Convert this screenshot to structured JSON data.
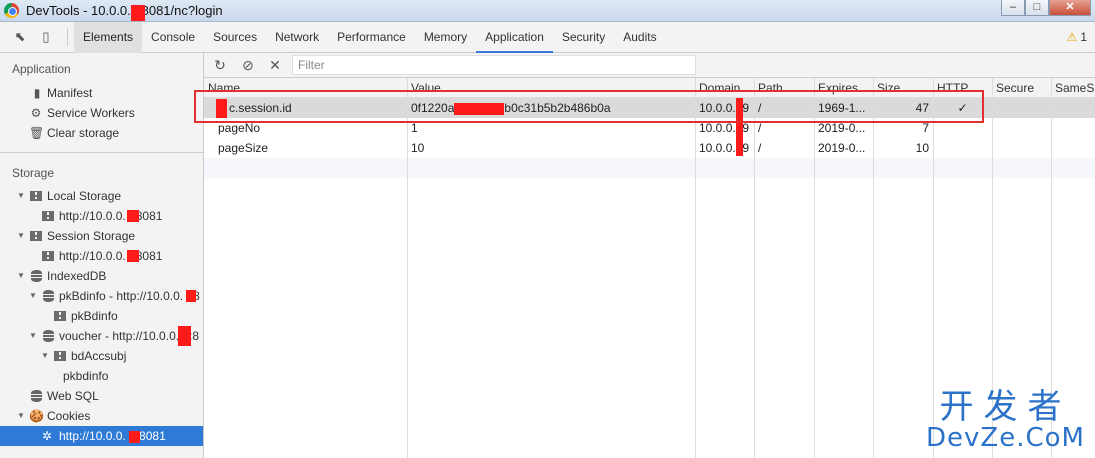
{
  "window": {
    "title": "DevTools - 10.0.0.   8081/nc?login",
    "buttons": {
      "min": "–",
      "max": "□",
      "close": "✕"
    }
  },
  "tabs": [
    {
      "label": "Elements"
    },
    {
      "label": "Console"
    },
    {
      "label": "Sources"
    },
    {
      "label": "Network"
    },
    {
      "label": "Performance"
    },
    {
      "label": "Memory"
    },
    {
      "label": "Application"
    },
    {
      "label": "Security"
    },
    {
      "label": "Audits"
    }
  ],
  "warnings": {
    "count": "1"
  },
  "sidebar": {
    "application_title": "Application",
    "application_items": [
      {
        "label": "Manifest",
        "icon": "document-icon"
      },
      {
        "label": "Service Workers",
        "icon": "gear-icon"
      },
      {
        "label": "Clear storage",
        "icon": "trash-icon"
      }
    ],
    "storage_title": "Storage",
    "storage_items": [
      {
        "label": "Local Storage",
        "level": 0,
        "icon": "grid-icon",
        "arrow": "▼"
      },
      {
        "label": "http://10.0.0.   8081",
        "level": 1,
        "icon": "grid-icon"
      },
      {
        "label": "Session Storage",
        "level": 0,
        "icon": "grid-icon",
        "arrow": "▼"
      },
      {
        "label": "http://10.0.0.   8081",
        "level": 1,
        "icon": "grid-icon"
      },
      {
        "label": "IndexedDB",
        "level": 0,
        "icon": "database-icon",
        "arrow": "▼"
      },
      {
        "label": "pkBdinfo - http://10.0.0.  :8",
        "level": 1,
        "icon": "database-icon",
        "arrow": "▼"
      },
      {
        "label": "pkBdinfo",
        "level": 2,
        "icon": "grid-icon"
      },
      {
        "label": "voucher - http://10.0.0.   :8",
        "level": 1,
        "icon": "database-icon",
        "arrow": "▼"
      },
      {
        "label": "bdAccsubj",
        "level": 2,
        "icon": "grid-icon",
        "arrow": "▼"
      },
      {
        "label": "pkbdinfo",
        "level": 3
      },
      {
        "label": "Web SQL",
        "level": 0,
        "icon": "database-icon"
      },
      {
        "label": "Cookies",
        "level": 0,
        "icon": "cookie-icon",
        "arrow": "▼"
      },
      {
        "label": "http://10.0.0.   :8081",
        "level": 1,
        "icon": "cookie-icon",
        "selected": true
      }
    ]
  },
  "toolbar": {
    "filter_placeholder": "Filter"
  },
  "cookies": {
    "columns": [
      "Name",
      "Value",
      "Domain",
      "Path",
      "Expires ...",
      "Size",
      "HTTP",
      "Secure",
      "SameSi"
    ],
    "rows": [
      {
        "name": "c.session.id",
        "value_a": "0f1220a",
        "value_b": "b0c31b5b2b486b0a",
        "domain": "10.0.0.  9",
        "path": "/",
        "expires": "1969-1...",
        "size": "47",
        "http": "✓",
        "secure": "",
        "samesite": "",
        "selected": true
      },
      {
        "name": "pageNo",
        "value_a": "1",
        "value_b": "",
        "domain": "10.0.0.  9",
        "path": "/",
        "expires": "2019-0...",
        "size": "7",
        "http": "",
        "secure": "",
        "samesite": ""
      },
      {
        "name": "pageSize",
        "value_a": "10",
        "value_b": "",
        "domain": "10.0.0.  9",
        "path": "/",
        "expires": "2019-0...",
        "size": "10",
        "http": "",
        "secure": "",
        "samesite": ""
      }
    ]
  },
  "watermark": {
    "cn": "开发者",
    "en": "DevZe.CoM"
  },
  "colors": {
    "accent": "#2e7ad6",
    "highlight": "#e03030",
    "redaction": "#ff1a1a",
    "tab_underline": "#3879d9"
  }
}
